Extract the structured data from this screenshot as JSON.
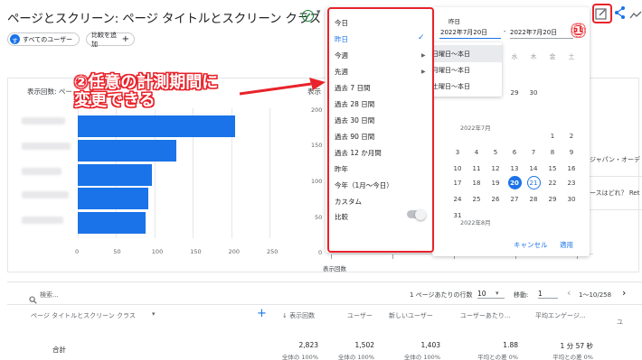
{
  "header": {
    "title": "ページとスクリーン: ページ タイトルとスクリーン クラス",
    "segment_chip": "すべてのユーザー",
    "segment_avatar": "す",
    "add_compare_chip": "比較を追加"
  },
  "card_left": {
    "title": "表示回数: ペー",
    "x_ticks": [
      "0",
      "50",
      "100",
      "150",
      "200",
      "250"
    ]
  },
  "chart_data": {
    "type": "bar",
    "orientation": "horizontal",
    "title": "表示回数: ペー",
    "categories": [
      "",
      "",
      "",
      "",
      ""
    ],
    "values": [
      205,
      128,
      97,
      92,
      89
    ],
    "xlim": [
      0,
      250
    ],
    "xlabel": "",
    "colors": [
      "#1a73e8"
    ]
  },
  "card_right": {
    "title_fragment": "表示",
    "y_ticks": [
      "200",
      "150",
      "100",
      "50",
      "0"
    ],
    "axis_label": "表示回数",
    "legend_fragment_1": "ジャパン・オーデ",
    "legend_fragment_2": "ースはどれ？ Ret"
  },
  "dropdown": {
    "items": [
      {
        "label": "今日"
      },
      {
        "label": "昨日",
        "active": true
      },
      {
        "label": "今週",
        "submenu": true
      },
      {
        "label": "先週",
        "submenu": true
      },
      {
        "label": "過去 7 日間"
      },
      {
        "label": "過去 28 日間"
      },
      {
        "label": "過去 30 日間"
      },
      {
        "label": "過去 90 日間"
      },
      {
        "label": "過去 12 か月間"
      },
      {
        "label": "昨年"
      },
      {
        "label": "今年（1月〜今日）"
      },
      {
        "label": "カスタム"
      }
    ],
    "compare_label": "比較",
    "check_icon": "check-icon",
    "chevron_icon": "chevron-right-icon"
  },
  "submenu": {
    "items": [
      "日曜日〜本日",
      "月曜日〜本日",
      "土曜日〜本日"
    ]
  },
  "date_picker": {
    "label": "昨日",
    "start_date": "2022年7月20日",
    "end_date": "2022年7月20日",
    "separator": "-",
    "weekdays": [
      "水",
      "木",
      "金",
      "土"
    ],
    "top_rows": [
      [
        "",
        "",
        "",
        ""
      ],
      [
        "29",
        "30"
      ]
    ],
    "month_july": "2022年7月",
    "month_august": "2022年8月",
    "july_rows": [
      [
        "",
        "",
        "",
        "",
        "",
        "1",
        "2"
      ],
      [
        "3",
        "4",
        "5",
        "6",
        "7",
        "8",
        "9"
      ],
      [
        "10",
        "11",
        "12",
        "13",
        "14",
        "15",
        "16"
      ],
      [
        "17",
        "18",
        "19",
        "20",
        "21",
        "22",
        "23"
      ],
      [
        "24",
        "25",
        "26",
        "27",
        "28",
        "29",
        "30"
      ],
      [
        "31",
        "",
        "",
        "",
        "",
        "",
        ""
      ]
    ],
    "selected_day": "20",
    "today_day": "21",
    "cancel_label": "キャンセル",
    "apply_label": "適用"
  },
  "annotations": {
    "step2_text": "②任意の計測期間に\n変更できる",
    "step1_text": "①"
  },
  "table": {
    "search_placeholder": "検索...",
    "rows_per_page_label": "1 ページあたりの行数",
    "rows_per_page_value": "10",
    "goto_label": "移動:",
    "goto_value": "1",
    "pagination": "1〜10/258",
    "columns": [
      "ページ タイトルとスクリーン クラス",
      "表示回数",
      "ユーザー",
      "新しいユーザー",
      "ユーザーあたり...",
      "平均エンゲージ...",
      "ユ"
    ],
    "total_label": "合計",
    "totals": [
      "2,823",
      "1,502",
      "1,403",
      "1.88",
      "1 分 57 秒"
    ],
    "totals_sub": [
      "全体の 100%",
      "全体の 100%",
      "全体の 100%",
      "平均との差 0%",
      "平均との差 0%"
    ]
  },
  "colors": {
    "accent": "#1a73e8",
    "annotation_red": "#e8232b"
  }
}
